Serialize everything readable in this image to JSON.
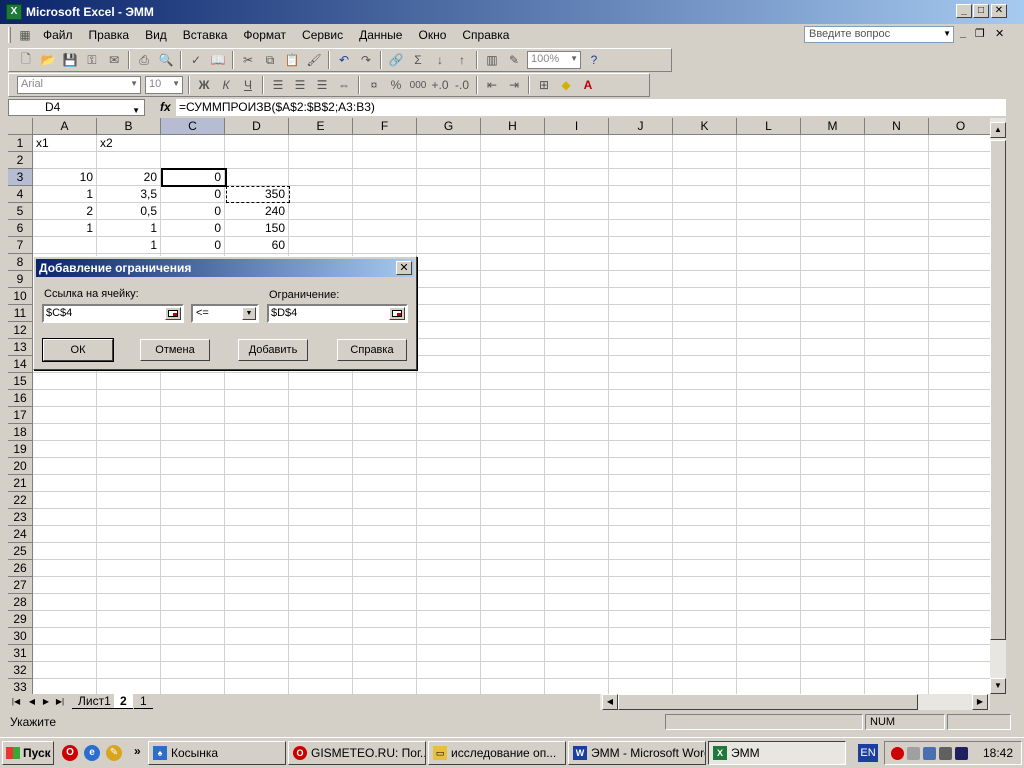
{
  "window": {
    "title": "Microsoft Excel - ЭММ",
    "app_icon": "excel-icon"
  },
  "menu": {
    "items": [
      "Файл",
      "Правка",
      "Вид",
      "Вставка",
      "Формат",
      "Сервис",
      "Данные",
      "Окно",
      "Справка"
    ],
    "ask_placeholder": "Введите вопрос"
  },
  "toolbar": {
    "zoom": "100%",
    "font_name": "Arial",
    "font_size": "10",
    "bold": "Ж",
    "italic": "К",
    "underline": "Ч",
    "percent": "%",
    "thousands": "000",
    "sum": "Σ"
  },
  "formula_bar": {
    "name_box": "D4",
    "fx": "fx",
    "formula": "=СУММПРОИЗВ($A$2:$B$2;A3:B3)"
  },
  "grid": {
    "columns": [
      "A",
      "B",
      "C",
      "D",
      "E",
      "F",
      "G",
      "H",
      "I",
      "J",
      "K",
      "L",
      "M",
      "N",
      "O"
    ],
    "rows": [
      "1",
      "2",
      "3",
      "4",
      "5",
      "6",
      "7",
      "8",
      "9",
      "10",
      "11",
      "12",
      "13",
      "14",
      "15",
      "16",
      "17",
      "18",
      "19",
      "20",
      "21",
      "22",
      "23",
      "24",
      "25",
      "26",
      "27",
      "28",
      "29",
      "30",
      "31",
      "32",
      "33"
    ],
    "cells": {
      "A1": "x1",
      "B1": "x2",
      "A3": "10",
      "B3": "20",
      "C3": "0",
      "A4": "1",
      "B4": "3,5",
      "C4": "0",
      "D4": "350",
      "A5": "2",
      "B5": "0,5",
      "C5": "0",
      "D5": "240",
      "A6": "1",
      "B6": "1",
      "C6": "0",
      "D6": "150",
      "B7": "1",
      "C7": "0",
      "D7": "60"
    }
  },
  "sheet_tabs": [
    "Лист1",
    "2",
    "1"
  ],
  "status": {
    "text": "Укажите",
    "num": "NUM"
  },
  "dialog": {
    "title": "Добавление ограничения",
    "cell_ref_label": "Ссылка на ячейку:",
    "cell_ref_value": "$C$4",
    "operator": "<=",
    "constraint_label": "Ограничение:",
    "constraint_value": "$D$4",
    "ok": "ОК",
    "cancel": "Отмена",
    "add": "Добавить",
    "help": "Справка"
  },
  "taskbar": {
    "start": "Пуск",
    "buttons": [
      "Косынка",
      "GISMETEO.RU: Пог...",
      "исследование оп...",
      "ЭММ - Microsoft Word",
      "ЭММ"
    ],
    "language": "EN",
    "clock": "18:42"
  }
}
